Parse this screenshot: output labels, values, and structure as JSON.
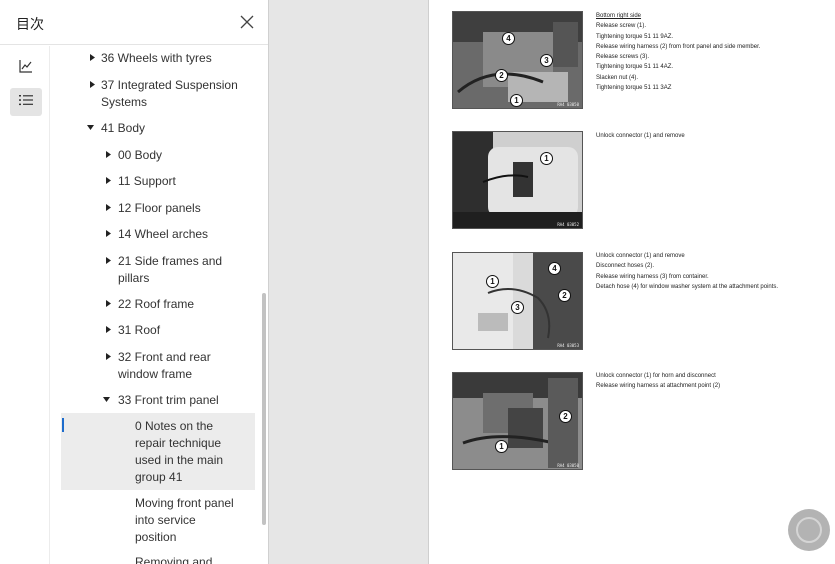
{
  "sidebar": {
    "title": "目次",
    "close_icon": "close-icon",
    "rail": {
      "chart_icon": "chart-line-icon",
      "list_icon": "list-icon"
    },
    "toc": [
      {
        "label_lines": [
          "36 Wheels with tyres"
        ],
        "arrow": "right"
      },
      {
        "label_lines": [
          "37 Integrated Suspension",
          "Systems"
        ],
        "arrow": "right"
      },
      {
        "label_lines": [
          "41 Body"
        ],
        "arrow": "down"
      },
      {
        "label_lines": [
          "00 Body"
        ],
        "arrow": "right"
      },
      {
        "label_lines": [
          "11 Support"
        ],
        "arrow": "right"
      },
      {
        "label_lines": [
          "12 Floor panels"
        ],
        "arrow": "right"
      },
      {
        "label_lines": [
          "14 Wheel arches"
        ],
        "arrow": "right"
      },
      {
        "label_lines": [
          "21 Side frames and",
          "pillars"
        ],
        "arrow": "right"
      },
      {
        "label_lines": [
          "22 Roof frame"
        ],
        "arrow": "right"
      },
      {
        "label_lines": [
          "31 Roof"
        ],
        "arrow": "right"
      },
      {
        "label_lines": [
          "32 Front and rear",
          "window frame"
        ],
        "arrow": "right"
      },
      {
        "label_lines": [
          "33 Front trim panel"
        ],
        "arrow": "down"
      },
      {
        "label_lines": [
          "0 Notes on the",
          "repair technique",
          "used in the main",
          "group 41"
        ],
        "arrow": "none",
        "selected": true
      },
      {
        "label_lines": [
          "Moving front panel",
          "into service",
          "position"
        ],
        "arrow": "none"
      },
      {
        "label_lines": [
          "Removing and"
        ],
        "arrow": "none"
      }
    ]
  },
  "document": {
    "steps": [
      {
        "photo_code": "RA4 03050",
        "lines": [
          "Bottom right side",
          "Release screw (1).",
          "Tightening torque 51 11 9AZ.",
          "Release wiring harness (2) from front panel and side member.",
          "Release screws (3).",
          "Tightening torque 51 11 4AZ.",
          "Slacken nut (4).",
          "Tightening torque 51 11 3AZ"
        ],
        "callouts": [
          "4",
          "3",
          "2",
          "1"
        ]
      },
      {
        "photo_code": "RA4 03052",
        "lines": [
          "Unlock connector (1) and remove"
        ],
        "callouts": [
          "1"
        ]
      },
      {
        "photo_code": "RA4 03053",
        "lines": [
          "Unlock connector (1) and remove",
          "Disconnect hoses (2).",
          "Release wiring harness (3) from container.",
          "Detach hose (4) for window washer system at the attachment points."
        ],
        "callouts": [
          "4",
          "1",
          "2",
          "3"
        ]
      },
      {
        "photo_code": "RA4 03050",
        "lines": [
          "Unlock connector (1) for horn and disconnect",
          "Release wiring harness at attachment point (2)"
        ],
        "callouts": [
          "2",
          "1"
        ]
      }
    ]
  }
}
